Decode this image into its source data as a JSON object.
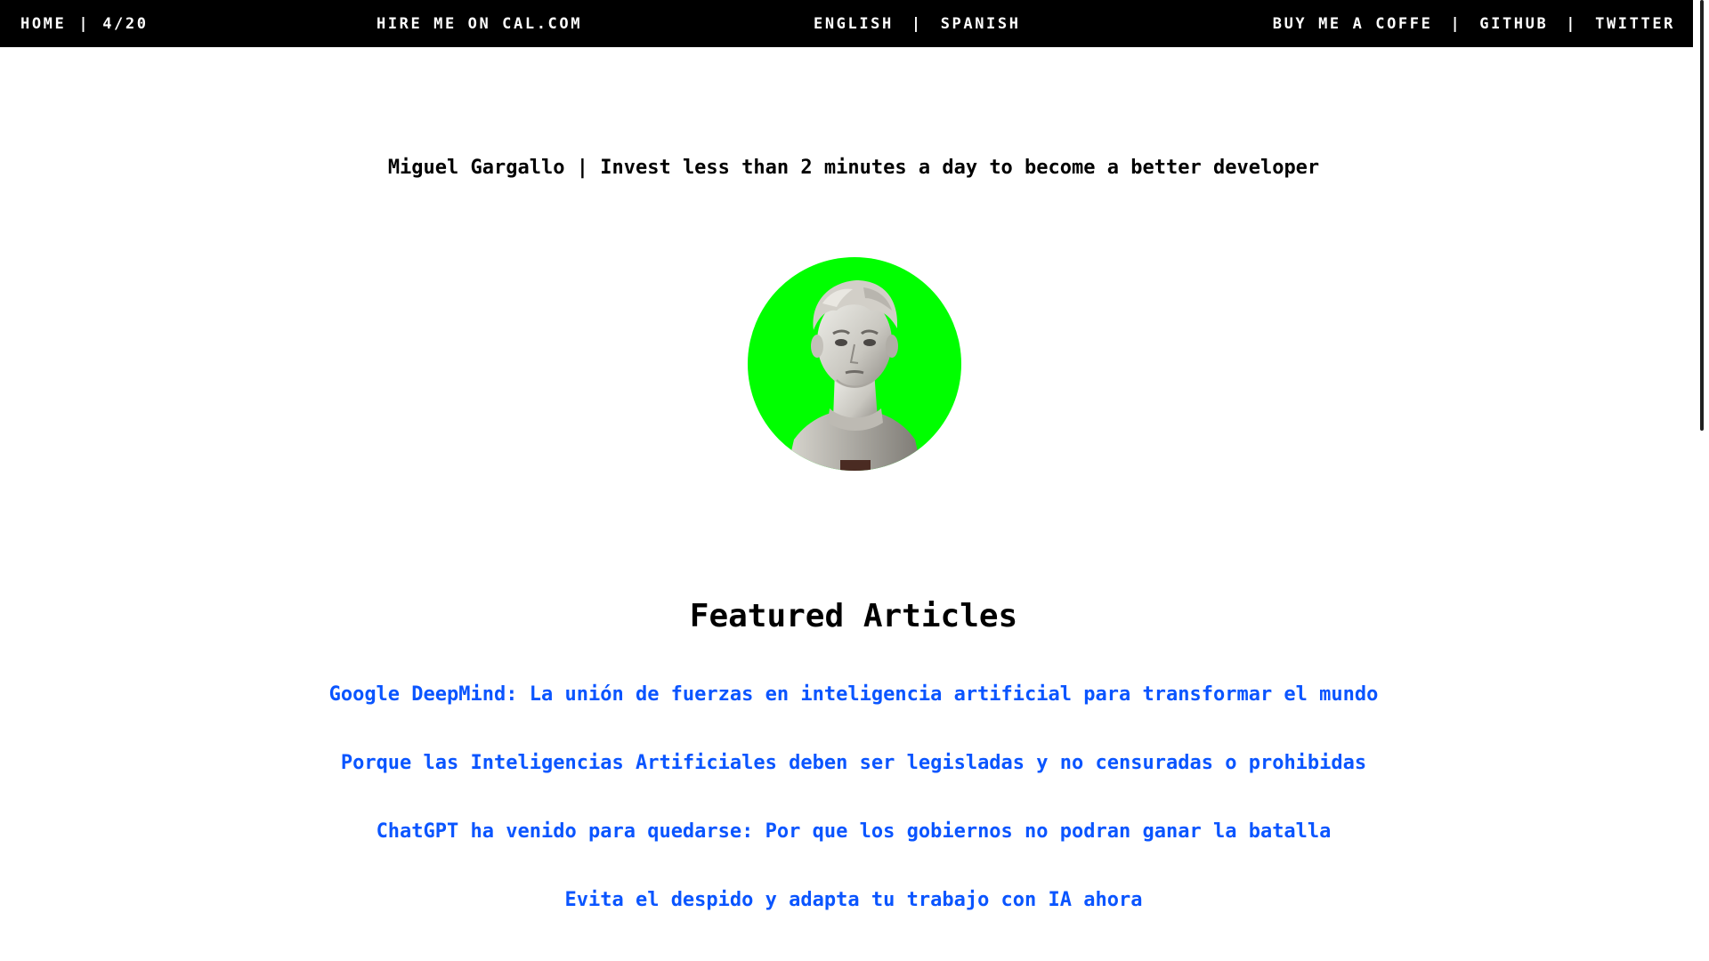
{
  "nav": {
    "home": "HOME",
    "page_counter": "4/20",
    "hire": "HIRE ME ON CAL.COM",
    "english": "ENGLISH",
    "spanish": "SPANISH",
    "coffee": "BUY ME A COFFE",
    "github": "GITHUB",
    "twitter": "TWITTER",
    "separator": "|"
  },
  "header": {
    "tagline": "Miguel Gargallo | Invest less than 2 minutes a day to become a better developer"
  },
  "avatar": {
    "icon": "marble-bust-portrait",
    "background_color": "#00ff00"
  },
  "featured": {
    "title": "Featured Articles",
    "articles": [
      "Google DeepMind: La unión de fuerzas en inteligencia artificial para transformar el mundo",
      "Porque las Inteligencias Artificiales deben ser legisladas y no censuradas o prohibidas",
      "ChatGPT ha venido para quedarse: Por que los gobiernos no podran ganar la batalla",
      "Evita el despido y adapta tu trabajo con IA ahora"
    ],
    "link_color": "#0a55ff"
  }
}
